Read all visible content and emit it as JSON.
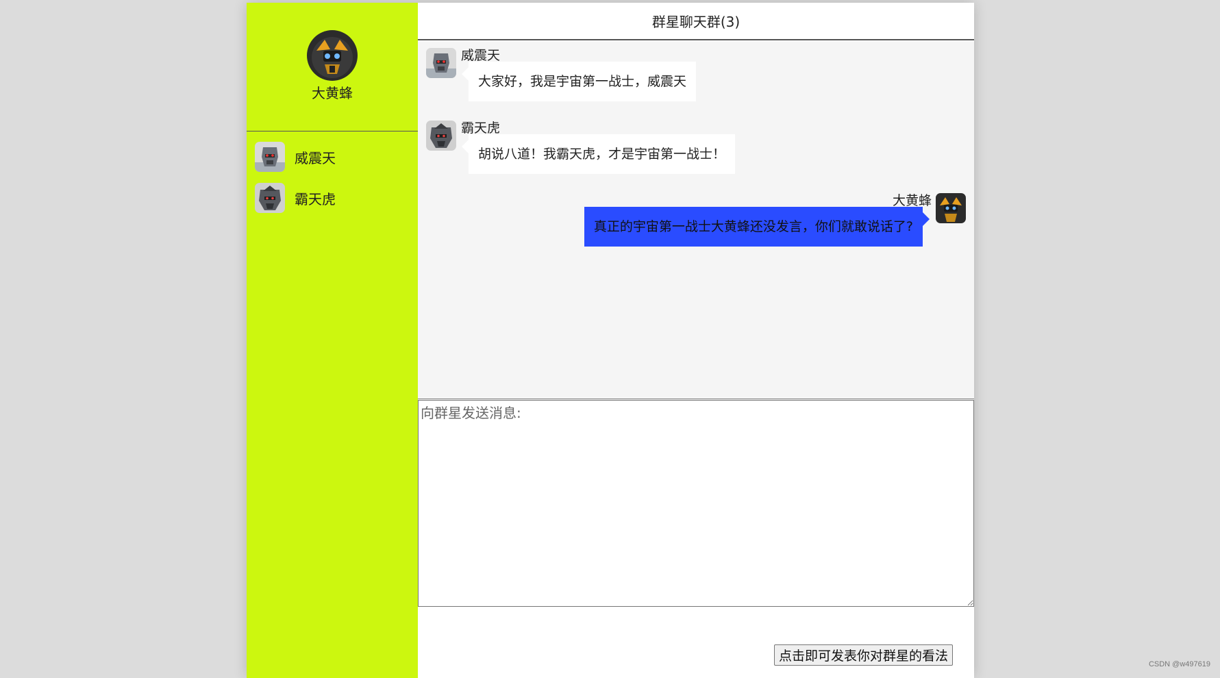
{
  "sidebar": {
    "me": {
      "name": "大黄蜂",
      "avatar": "bumblebee-avatar"
    },
    "contacts": [
      {
        "name": "威震天",
        "avatar": "megatron-avatar"
      },
      {
        "name": "霸天虎",
        "avatar": "decepticon-avatar"
      }
    ]
  },
  "header": {
    "title": "群星聊天群(3)"
  },
  "messages": [
    {
      "sender": "威震天",
      "text": "大家好，我是宇宙第一战士，威震天",
      "side": "left",
      "avatar": "megatron-avatar"
    },
    {
      "sender": "霸天虎",
      "text": "胡说八道！我霸天虎，才是宇宙第一战士！",
      "side": "left",
      "avatar": "decepticon-avatar"
    },
    {
      "sender": "大黄蜂",
      "text": "真正的宇宙第一战士大黄蜂还没发言，你们就敢说话了?",
      "side": "right",
      "avatar": "bumblebee-avatar"
    }
  ],
  "composer": {
    "placeholder": "向群星发送消息:",
    "value": ""
  },
  "send_button": {
    "label": "点击即可发表你对群星的看法"
  },
  "watermark": "CSDN @w497619",
  "colors": {
    "sidebar_bg": "#ccf70f",
    "chat_bg": "#f5f5f5",
    "own_bubble": "#2a4cff",
    "other_bubble": "#ffffff"
  }
}
